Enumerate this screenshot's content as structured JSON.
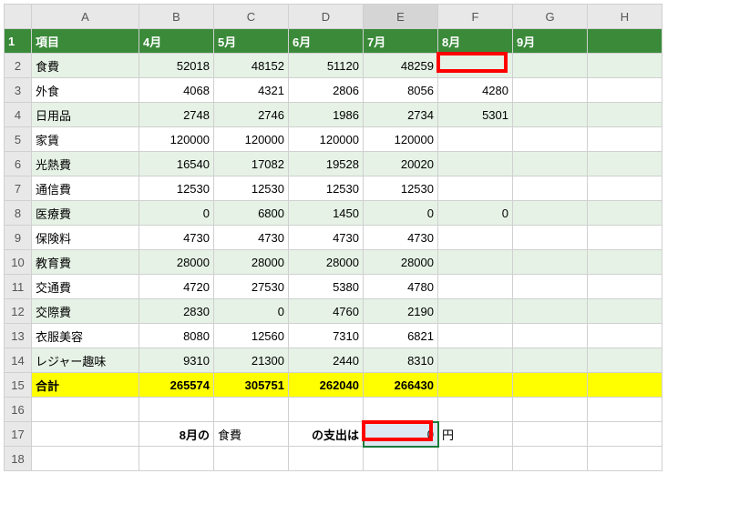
{
  "columns": [
    "A",
    "B",
    "C",
    "D",
    "E",
    "F",
    "G",
    "H"
  ],
  "header": {
    "A": "項目",
    "B": "4月",
    "C": "5月",
    "D": "6月",
    "E": "7月",
    "F": "8月",
    "G": "9月"
  },
  "rows": [
    {
      "A": "食費",
      "B": "52018",
      "C": "48152",
      "D": "51120",
      "E": "48259",
      "F": "",
      "G": "",
      "band": true
    },
    {
      "A": "外食",
      "B": "4068",
      "C": "4321",
      "D": "2806",
      "E": "8056",
      "F": "4280",
      "G": "",
      "band": false
    },
    {
      "A": "日用品",
      "B": "2748",
      "C": "2746",
      "D": "1986",
      "E": "2734",
      "F": "5301",
      "G": "",
      "band": true
    },
    {
      "A": "家賃",
      "B": "120000",
      "C": "120000",
      "D": "120000",
      "E": "120000",
      "F": "",
      "G": "",
      "band": false
    },
    {
      "A": "光熱費",
      "B": "16540",
      "C": "17082",
      "D": "19528",
      "E": "20020",
      "F": "",
      "G": "",
      "band": true
    },
    {
      "A": "通信費",
      "B": "12530",
      "C": "12530",
      "D": "12530",
      "E": "12530",
      "F": "",
      "G": "",
      "band": false
    },
    {
      "A": "医療費",
      "B": "0",
      "C": "6800",
      "D": "1450",
      "E": "0",
      "F": "0",
      "G": "",
      "band": true
    },
    {
      "A": "保険料",
      "B": "4730",
      "C": "4730",
      "D": "4730",
      "E": "4730",
      "F": "",
      "G": "",
      "band": false
    },
    {
      "A": "教育費",
      "B": "28000",
      "C": "28000",
      "D": "28000",
      "E": "28000",
      "F": "",
      "G": "",
      "band": true
    },
    {
      "A": "交通費",
      "B": "4720",
      "C": "27530",
      "D": "5380",
      "E": "4780",
      "F": "",
      "G": "",
      "band": false
    },
    {
      "A": "交際費",
      "B": "2830",
      "C": "0",
      "D": "4760",
      "E": "2190",
      "F": "",
      "G": "",
      "band": true
    },
    {
      "A": "衣服美容",
      "B": "8080",
      "C": "12560",
      "D": "7310",
      "E": "6821",
      "F": "",
      "G": "",
      "band": false
    },
    {
      "A": "レジャー趣味",
      "B": "9310",
      "C": "21300",
      "D": "2440",
      "E": "8310",
      "F": "",
      "G": "",
      "band": true
    }
  ],
  "total": {
    "A": "合計",
    "B": "265574",
    "C": "305751",
    "D": "262040",
    "E": "266430",
    "F": "",
    "G": ""
  },
  "lookup": {
    "month_label": "8月の",
    "category": "食費",
    "mid_label": "の支出は",
    "result": "0",
    "unit": "円"
  }
}
